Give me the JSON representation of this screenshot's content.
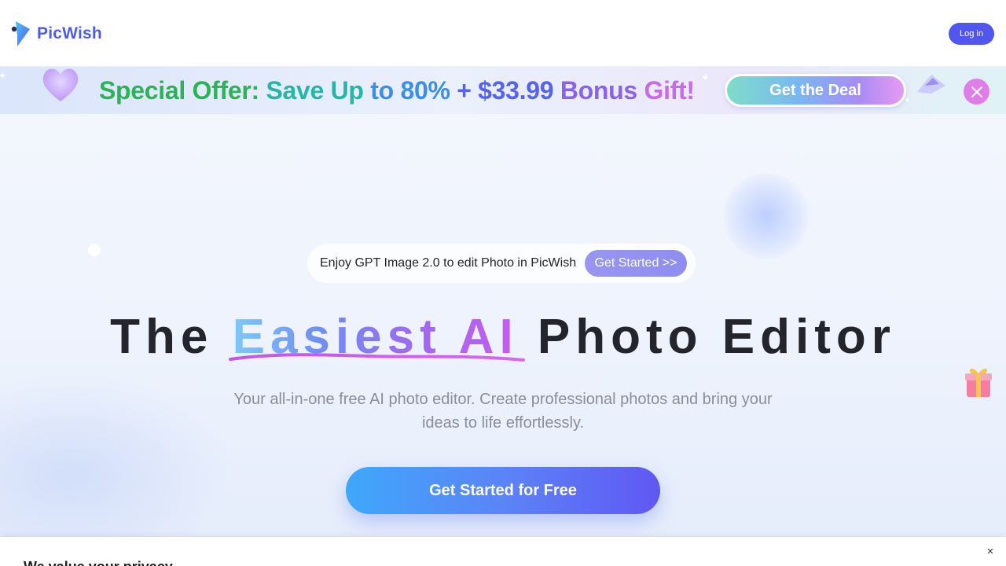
{
  "header": {
    "brand": "PicWish",
    "login_label": "Log in"
  },
  "promo": {
    "text_a": "Special Offer: ",
    "text_b": "Save Up ",
    "text_c": "to 80% ",
    "text_d": "+ $33.99 ",
    "text_e": "Bonus ",
    "text_f": "Gift!",
    "deal_label": "Get the Deal"
  },
  "hero": {
    "announcement": "Enjoy GPT Image 2.0 to edit Photo in PicWish",
    "announcement_button": "Get Started >>",
    "headline_start": "The ",
    "headline_highlight": "Easiest AI",
    "headline_end": " Photo Editor",
    "subtitle": "Your all-in-one free AI photo editor. Create professional photos and bring your ideas to life effortlessly.",
    "cta_label": "Get Started for Free"
  },
  "privacy": {
    "title": "We value your privacy",
    "close_glyph": "×"
  },
  "colors": {
    "brand": "#4d5be8",
    "login_bg": "#5156ee",
    "cta_start": "#3fa7fb",
    "cta_end": "#6057f3",
    "promo_close": "#e07ee9"
  }
}
